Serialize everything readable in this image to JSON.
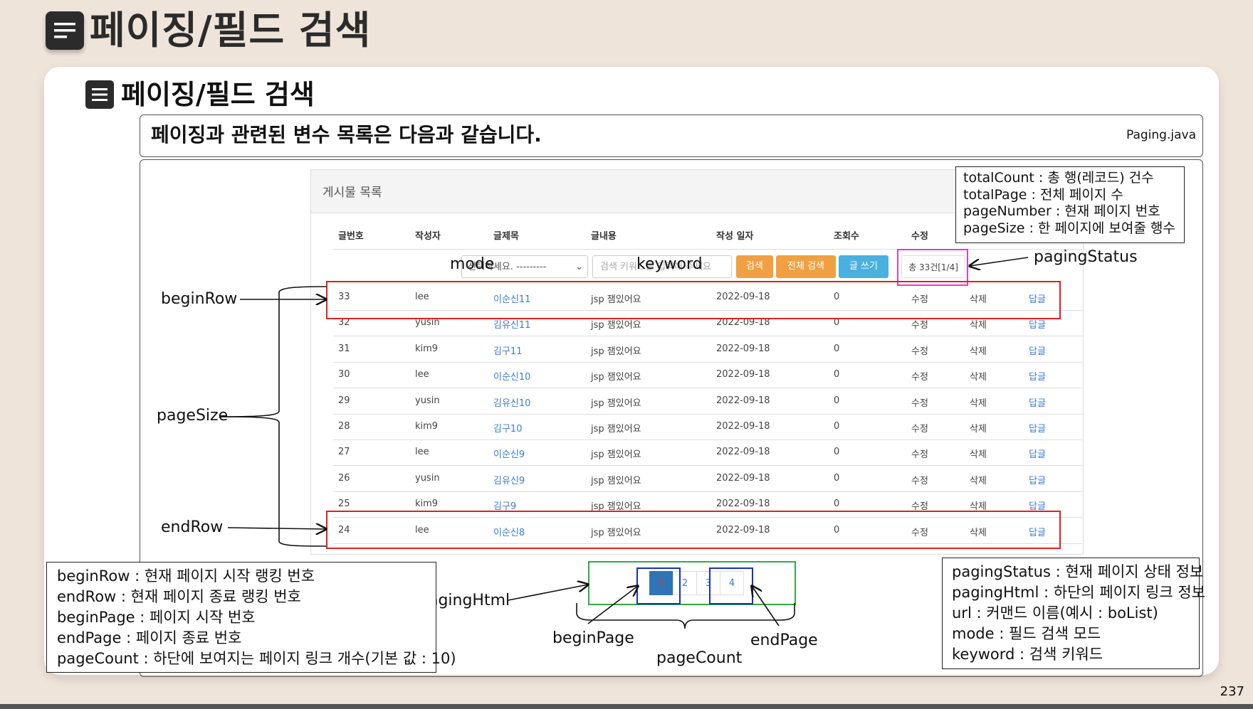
{
  "slide_title": "페이징/필드 검색",
  "section_title": "페이징/필드 검색",
  "info_text": "페이징과 관련된 변수 목록은 다음과 같습니다.",
  "file_name": "Paging.java",
  "board": {
    "title": "게시물 목록",
    "headers": [
      "글번호",
      "작성자",
      "글제목",
      "글내용",
      "작성 일자",
      "조회수",
      "수정"
    ],
    "select_placeholder": "선택하세요. ---------",
    "keyword_placeholder": "검색 키워드를 입력해 주세요",
    "search_button": "검색",
    "all_search_button": "전체 검색",
    "write_button": "글 쓰기",
    "status_text": "총 33건[1/4]",
    "rows": [
      {
        "no": "33",
        "writer": "lee",
        "subject": "이순신11",
        "content": "jsp 잼있어요",
        "date": "2022-09-18",
        "hit": "0",
        "edit": "수정",
        "del": "삭제",
        "reply": "답글"
      },
      {
        "no": "32",
        "writer": "yusin",
        "subject": "김유신11",
        "content": "jsp 잼있어요",
        "date": "2022-09-18",
        "hit": "0",
        "edit": "수정",
        "del": "삭제",
        "reply": "답글"
      },
      {
        "no": "31",
        "writer": "kim9",
        "subject": "김구11",
        "content": "jsp 잼있어요",
        "date": "2022-09-18",
        "hit": "0",
        "edit": "수정",
        "del": "삭제",
        "reply": "답글"
      },
      {
        "no": "30",
        "writer": "lee",
        "subject": "이순신10",
        "content": "jsp 잼있어요",
        "date": "2022-09-18",
        "hit": "0",
        "edit": "수정",
        "del": "삭제",
        "reply": "답글"
      },
      {
        "no": "29",
        "writer": "yusin",
        "subject": "김유신10",
        "content": "jsp 잼있어요",
        "date": "2022-09-18",
        "hit": "0",
        "edit": "수정",
        "del": "삭제",
        "reply": "답글"
      },
      {
        "no": "28",
        "writer": "kim9",
        "subject": "김구10",
        "content": "jsp 잼있어요",
        "date": "2022-09-18",
        "hit": "0",
        "edit": "수정",
        "del": "삭제",
        "reply": "답글"
      },
      {
        "no": "27",
        "writer": "lee",
        "subject": "이순신9",
        "content": "jsp 잼있어요",
        "date": "2022-09-18",
        "hit": "0",
        "edit": "수정",
        "del": "삭제",
        "reply": "답글"
      },
      {
        "no": "26",
        "writer": "yusin",
        "subject": "김유신9",
        "content": "jsp 잼있어요",
        "date": "2022-09-18",
        "hit": "0",
        "edit": "수정",
        "del": "삭제",
        "reply": "답글"
      },
      {
        "no": "25",
        "writer": "kim9",
        "subject": "김구9",
        "content": "jsp 잼있어요",
        "date": "2022-09-18",
        "hit": "0",
        "edit": "수정",
        "del": "삭제",
        "reply": "답글"
      },
      {
        "no": "24",
        "writer": "lee",
        "subject": "이순신8",
        "content": "jsp 잼있어요",
        "date": "2022-09-18",
        "hit": "0",
        "edit": "수정",
        "del": "삭제",
        "reply": "답글"
      }
    ],
    "pages": [
      "1",
      "2",
      "3",
      "4"
    ]
  },
  "labels": {
    "mode": "mode",
    "keyword": "keyword",
    "pagingStatus": "pagingStatus",
    "beginRow": "beginRow",
    "pageSize": "pageSize",
    "endRow": "endRow",
    "pagingHtml": "pagingHtml",
    "beginPage": "beginPage",
    "endPage": "endPage",
    "pageCount": "pageCount"
  },
  "notes": {
    "top_right": [
      "totalCount : 총 행(레코드) 건수",
      "totalPage : 전체 페이지 수",
      "pageNumber : 현재 페이지 번호",
      "pageSize : 한 페이지에 보여줄 행수"
    ],
    "bottom_left": [
      "beginRow : 현재 페이지 시작 랭킹 번호",
      "endRow : 현재 페이지 종료 랭킹 번호",
      "beginPage : 페이지 시작 번호",
      "endPage : 페이지 종료 번호",
      "pageCount : 하단에 보여지는 페이지 링크 개수(기본 값 : 10)"
    ],
    "bottom_right": [
      "pagingStatus : 현재 페이지 상태 정보",
      "pagingHtml : 하단의 페이지 링크 정보",
      "url : 커맨드 이름(예시 : boList)",
      "mode : 필드 검색 모드",
      "keyword : 검색 키워드"
    ]
  },
  "page_number": "237",
  "colors": {
    "background": "#efe4da",
    "dark": "#2b2b2b",
    "highlight_red": "#e02020",
    "highlight_green": "#33aa44",
    "highlight_blue": "#1530c0",
    "status_box": "#e040c0",
    "btn_orange": "#f0a040",
    "btn_blue": "#4ab0e0",
    "link_blue": "#3a7bd5"
  }
}
